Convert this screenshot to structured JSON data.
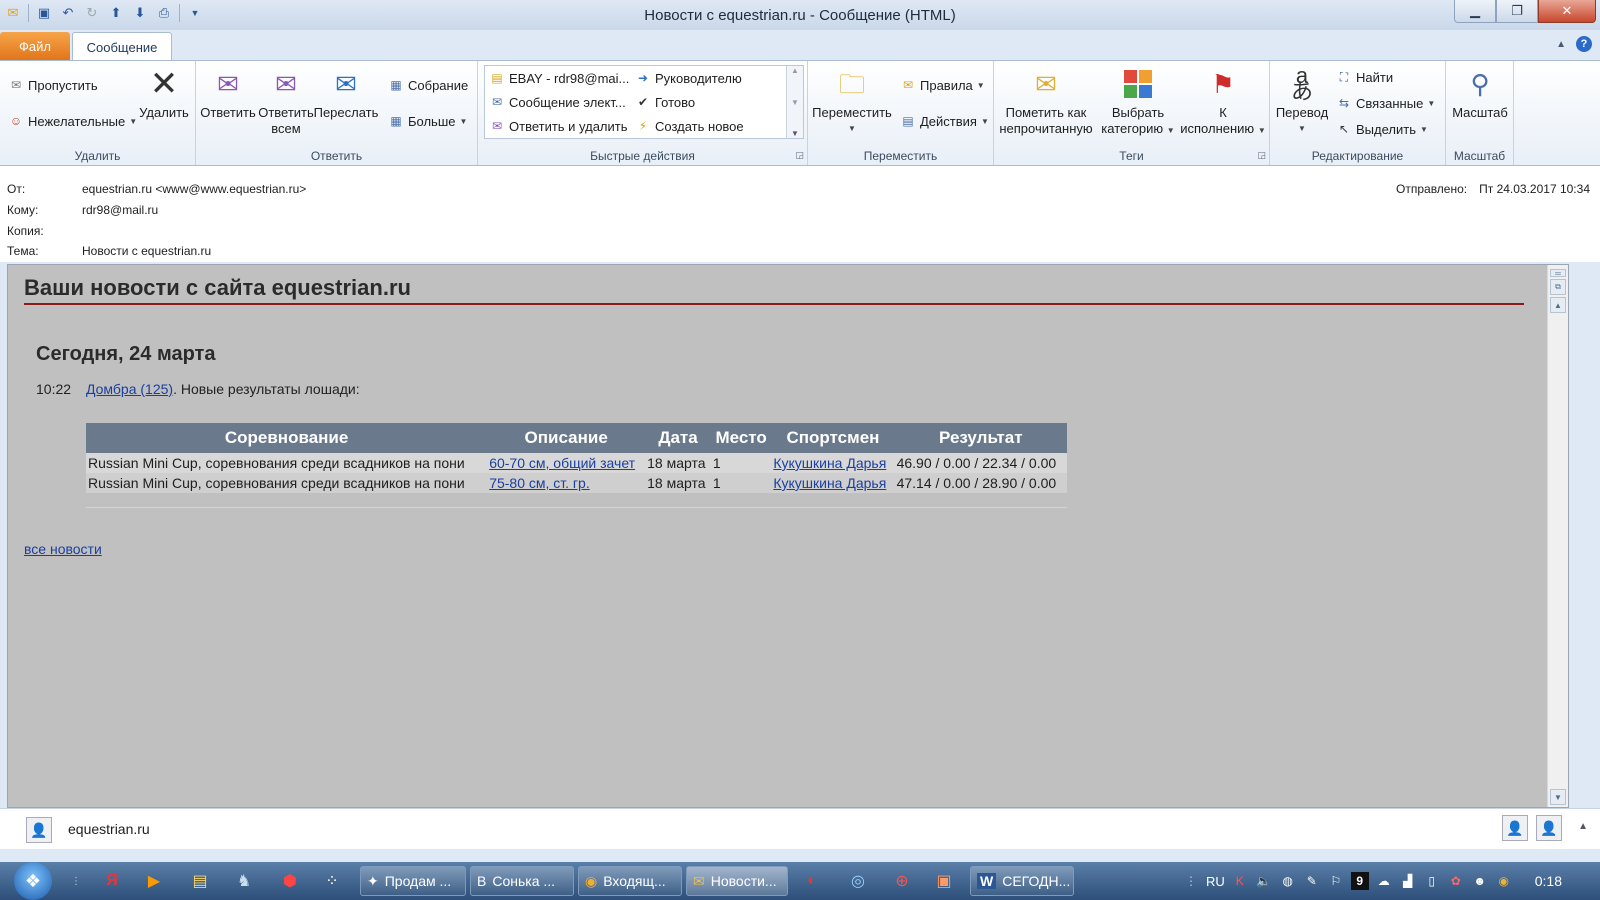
{
  "window": {
    "title": "Новости с equestrian.ru - Сообщение (HTML)"
  },
  "tabs": {
    "file": "Файл",
    "message": "Сообщение"
  },
  "ribbon": {
    "delete_group": {
      "label": "Удалить",
      "ignore": "Пропустить",
      "junk": "Нежелательные",
      "delete": "Удалить"
    },
    "reply_group": {
      "label": "Ответить",
      "reply": "Ответить",
      "reply_all_1": "Ответить",
      "reply_all_2": "всем",
      "forward": "Переслать",
      "meeting": "Собрание",
      "more": "Больше"
    },
    "quick_steps": {
      "label": "Быстрые действия",
      "items": [
        "EBAY - rdr98@mai...",
        "Сообщение элект...",
        "Ответить и удалить",
        "Руководителю",
        "Готово",
        "Создать новое"
      ]
    },
    "move_group": {
      "label": "Переместить",
      "move": "Переместить",
      "rules": "Правила",
      "actions": "Действия"
    },
    "tags_group": {
      "label": "Теги",
      "mark_unread_1": "Пометить как",
      "mark_unread_2": "непрочитанную",
      "categorize_1": "Выбрать",
      "categorize_2": "категорию",
      "followup_1": "К",
      "followup_2": "исполнению"
    },
    "editing_group": {
      "label": "Редактирование",
      "translate": "Перевод",
      "find": "Найти",
      "related": "Связанные",
      "select": "Выделить"
    },
    "zoom_group": {
      "label": "Масштаб",
      "zoom": "Масштаб"
    }
  },
  "header": {
    "from_label": "От:",
    "from_value": "equestrian.ru <www@www.equestrian.ru>",
    "to_label": "Кому:",
    "to_value": "rdr98@mail.ru",
    "cc_label": "Копия:",
    "subject_label": "Тема:",
    "subject_value": "Новости с equestrian.ru",
    "sent_label": "Отправлено:",
    "sent_value": "Пт 24.03.2017 10:34"
  },
  "body": {
    "title": "Ваши новости с сайта equestrian.ru",
    "today": "Сегодня, 24 марта",
    "entry_time": "10:22",
    "entry_link": "Домбра (125)",
    "entry_text": ". Новые результаты лошади:",
    "table": {
      "headers": [
        "Соревнование",
        "Описание",
        "Дата",
        "Место",
        "Спортсмен",
        "Результат"
      ],
      "rows": [
        [
          "Russian Mini Cup, соревнования среди всадников на пони",
          "60-70 см, общий зачет",
          "18 марта",
          "1",
          "Кукушкина Дарья",
          "46.90 / 0.00 / 22.34 / 0.00"
        ],
        [
          "Russian Mini Cup, соревнования среди всадников на пони",
          "75-80 см, ст. гр.",
          "18 марта",
          "1",
          "Кукушкина Дарья",
          "47.14 / 0.00 / 28.90 / 0.00"
        ]
      ]
    },
    "all_news": "все новости"
  },
  "people_pane": {
    "name": "equestrian.ru"
  },
  "taskbar": {
    "tasks": [
      "Продам ...",
      "Сонька ...",
      "Входящ...",
      "Новости...",
      "СЕГОДН..."
    ],
    "lang": "RU",
    "tray_badge": "9",
    "clock": "0:18"
  },
  "colors": {
    "accent": "#e3751a",
    "link": "#1a3fa0",
    "rule": "#8b1a1a",
    "table_header": "#6a7a8c"
  }
}
